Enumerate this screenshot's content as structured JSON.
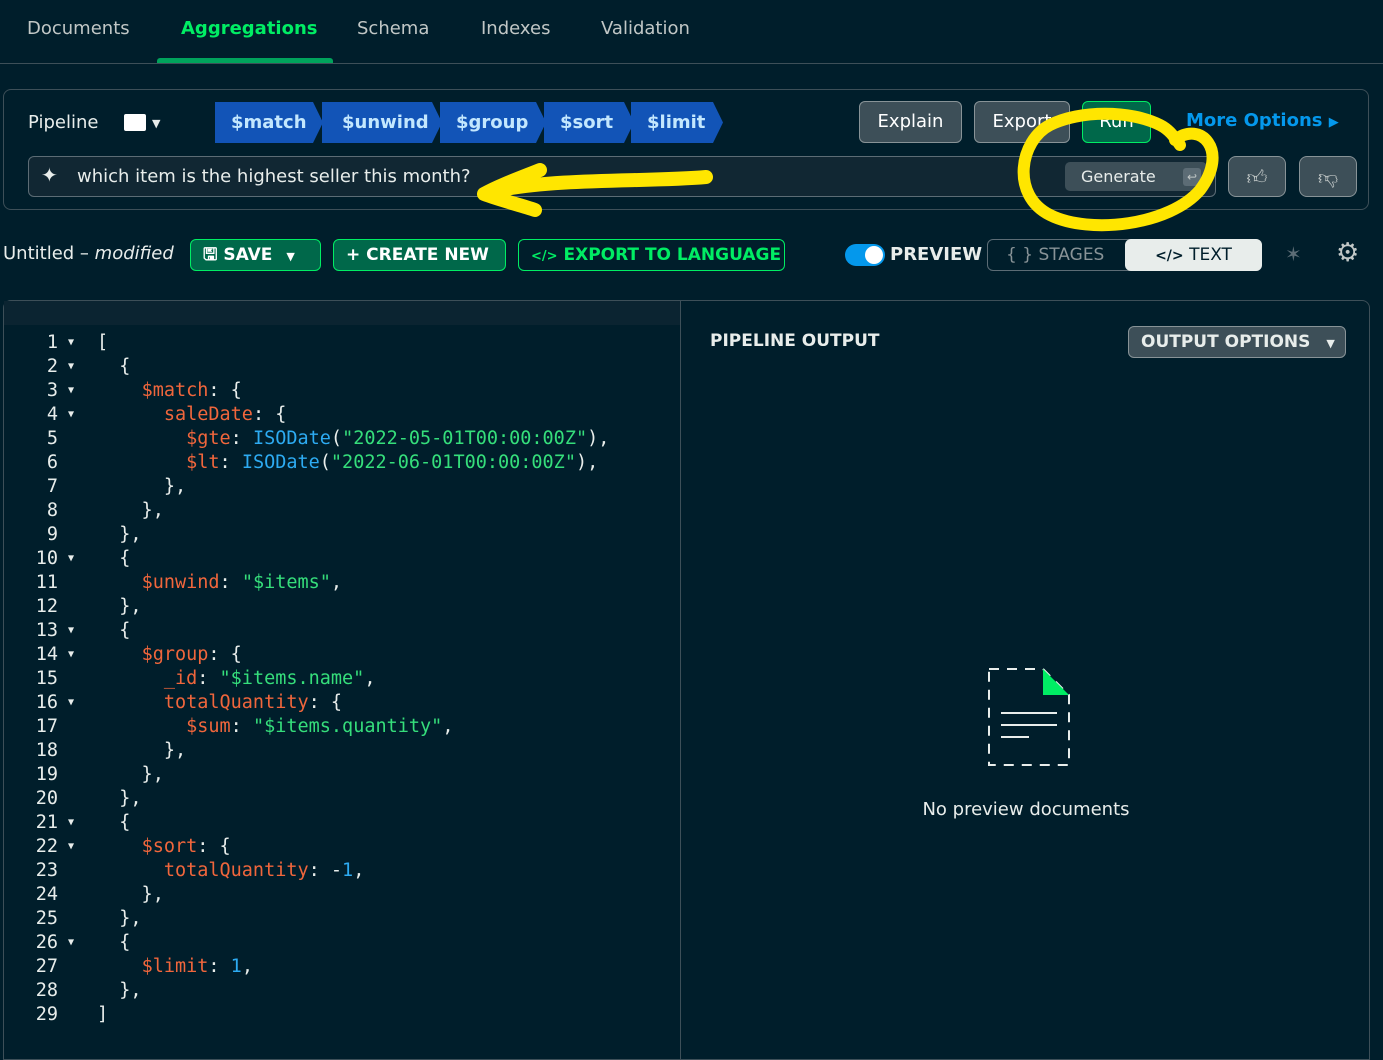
{
  "tabs": [
    "Documents",
    "Aggregations",
    "Schema",
    "Indexes",
    "Validation"
  ],
  "active_tab": "Aggregations",
  "pipeline": {
    "label": "Pipeline",
    "stages": [
      "$match",
      "$unwind",
      "$group",
      "$sort",
      "$limit"
    ],
    "buttons": {
      "explain": "Explain",
      "export": "Export",
      "run": "Run"
    },
    "more_options": "More Options"
  },
  "ai": {
    "prompt": "which item is the highest seller this month?",
    "generate": "Generate"
  },
  "toolbar": {
    "name": "Untitled",
    "modified": "modified",
    "save": "SAVE",
    "create_new": "CREATE NEW",
    "export_lang": "EXPORT TO LANGUAGE",
    "preview": "PREVIEW",
    "preview_on": true,
    "stages": "STAGES",
    "text": "TEXT"
  },
  "output": {
    "title": "PIPELINE OUTPUT",
    "options": "OUTPUT OPTIONS",
    "empty": "No preview documents"
  },
  "colors": {
    "accent": "#00ed64",
    "stage": "#1254b7",
    "link": "#0498ec",
    "annotation": "#ffe600",
    "key": "#f0663c",
    "string": "#35de7b"
  },
  "code": [
    [
      [
        "p",
        "["
      ]
    ],
    [
      [
        "p",
        "  {"
      ]
    ],
    [
      [
        "p",
        "    "
      ],
      [
        "k",
        "$match"
      ],
      [
        "p",
        ": {"
      ]
    ],
    [
      [
        "p",
        "      "
      ],
      [
        "k",
        "saleDate"
      ],
      [
        "p",
        ": {"
      ]
    ],
    [
      [
        "p",
        "        "
      ],
      [
        "k",
        "$gte"
      ],
      [
        "p",
        ": "
      ],
      [
        "f",
        "ISODate"
      ],
      [
        "p",
        "("
      ],
      [
        "s",
        "\"2022-05-01T00:00:00Z\""
      ],
      [
        "p",
        "),"
      ]
    ],
    [
      [
        "p",
        "        "
      ],
      [
        "k",
        "$lt"
      ],
      [
        "p",
        ": "
      ],
      [
        "f",
        "ISODate"
      ],
      [
        "p",
        "("
      ],
      [
        "s",
        "\"2022-06-01T00:00:00Z\""
      ],
      [
        "p",
        "),"
      ]
    ],
    [
      [
        "p",
        "      },"
      ]
    ],
    [
      [
        "p",
        "    },"
      ]
    ],
    [
      [
        "p",
        "  },"
      ]
    ],
    [
      [
        "p",
        "  {"
      ]
    ],
    [
      [
        "p",
        "    "
      ],
      [
        "k",
        "$unwind"
      ],
      [
        "p",
        ": "
      ],
      [
        "s",
        "\"$items\""
      ],
      [
        "p",
        ","
      ]
    ],
    [
      [
        "p",
        "  },"
      ]
    ],
    [
      [
        "p",
        "  {"
      ]
    ],
    [
      [
        "p",
        "    "
      ],
      [
        "k",
        "$group"
      ],
      [
        "p",
        ": {"
      ]
    ],
    [
      [
        "p",
        "      "
      ],
      [
        "k",
        "_id"
      ],
      [
        "p",
        ": "
      ],
      [
        "s",
        "\"$items.name\""
      ],
      [
        "p",
        ","
      ]
    ],
    [
      [
        "p",
        "      "
      ],
      [
        "k",
        "totalQuantity"
      ],
      [
        "p",
        ": {"
      ]
    ],
    [
      [
        "p",
        "        "
      ],
      [
        "k",
        "$sum"
      ],
      [
        "p",
        ": "
      ],
      [
        "s",
        "\"$items.quantity\""
      ],
      [
        "p",
        ","
      ]
    ],
    [
      [
        "p",
        "      },"
      ]
    ],
    [
      [
        "p",
        "    },"
      ]
    ],
    [
      [
        "p",
        "  },"
      ]
    ],
    [
      [
        "p",
        "  {"
      ]
    ],
    [
      [
        "p",
        "    "
      ],
      [
        "k",
        "$sort"
      ],
      [
        "p",
        ": {"
      ]
    ],
    [
      [
        "p",
        "      "
      ],
      [
        "k",
        "totalQuantity"
      ],
      [
        "p",
        ": -"
      ],
      [
        "n",
        "1"
      ],
      [
        "p",
        ","
      ]
    ],
    [
      [
        "p",
        "    },"
      ]
    ],
    [
      [
        "p",
        "  },"
      ]
    ],
    [
      [
        "p",
        "  {"
      ]
    ],
    [
      [
        "p",
        "    "
      ],
      [
        "k",
        "$limit"
      ],
      [
        "p",
        ": "
      ],
      [
        "n",
        "1"
      ],
      [
        "p",
        ","
      ]
    ],
    [
      [
        "p",
        "  },"
      ]
    ],
    [
      [
        "p",
        "]"
      ]
    ]
  ],
  "folded_lines": [
    1,
    2,
    3,
    4,
    10,
    13,
    14,
    16,
    21,
    22,
    26
  ]
}
